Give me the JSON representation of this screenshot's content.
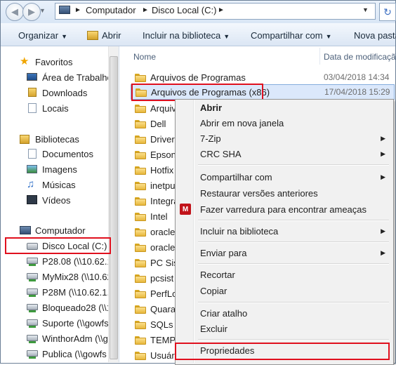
{
  "address": {
    "crumbs": [
      "Computador",
      "Disco Local (C:)"
    ]
  },
  "toolbar": {
    "organize": "Organizar",
    "open": "Abrir",
    "include": "Incluir na biblioteca",
    "share": "Compartilhar com",
    "new_folder": "Nova pasta"
  },
  "columns": {
    "name": "Nome",
    "date": "Data de modificação"
  },
  "nav": {
    "favorites": "Favoritos",
    "desktop": "Área de Trabalho",
    "downloads": "Downloads",
    "places": "Locais",
    "libraries": "Bibliotecas",
    "documents": "Documentos",
    "images": "Imagens",
    "music": "Músicas",
    "videos": "Vídeos",
    "computer": "Computador",
    "local_disk": "Disco Local (C:)",
    "drives": [
      "P28.08 (\\\\10.62.1.",
      "MyMix28 (\\\\10.62",
      "P28M (\\\\10.62.1.1",
      "Bloqueado28 (\\\\1",
      "Suporte (\\\\gowfs",
      "WinthorAdm (\\\\go",
      "Publica (\\\\gowfs"
    ]
  },
  "files": [
    {
      "name": "Arquivos de Programas",
      "date": "03/04/2018 14:34"
    },
    {
      "name": "Arquivos de Programas (x86)",
      "date": "17/04/2018 15:29"
    },
    {
      "name": "Arquiv",
      "date": ""
    },
    {
      "name": "Dell",
      "date": ""
    },
    {
      "name": "Drivers",
      "date": ""
    },
    {
      "name": "Epson",
      "date": ""
    },
    {
      "name": "Hotfix",
      "date": ""
    },
    {
      "name": "inetpu",
      "date": ""
    },
    {
      "name": "Integra",
      "date": ""
    },
    {
      "name": "Intel",
      "date": ""
    },
    {
      "name": "oracle",
      "date": ""
    },
    {
      "name": "oraclez",
      "date": ""
    },
    {
      "name": "PC Sist",
      "date": ""
    },
    {
      "name": "pcsist",
      "date": ""
    },
    {
      "name": "PerfLo",
      "date": ""
    },
    {
      "name": "Quarar",
      "date": ""
    },
    {
      "name": "SQLs",
      "date": ""
    },
    {
      "name": "TEMP",
      "date": ""
    },
    {
      "name": "Usuári",
      "date": ""
    }
  ],
  "menu": {
    "open": "Abrir",
    "open_new_window": "Abrir em nova janela",
    "zip": "7-Zip",
    "crc": "CRC SHA",
    "share_with": "Compartilhar com",
    "restore": "Restaurar versões anteriores",
    "scan": "Fazer varredura para encontrar ameaças",
    "include": "Incluir na biblioteca",
    "send_to": "Enviar para",
    "cut": "Recortar",
    "copy": "Copiar",
    "shortcut": "Criar atalho",
    "delete": "Excluir",
    "properties": "Propriedades"
  }
}
